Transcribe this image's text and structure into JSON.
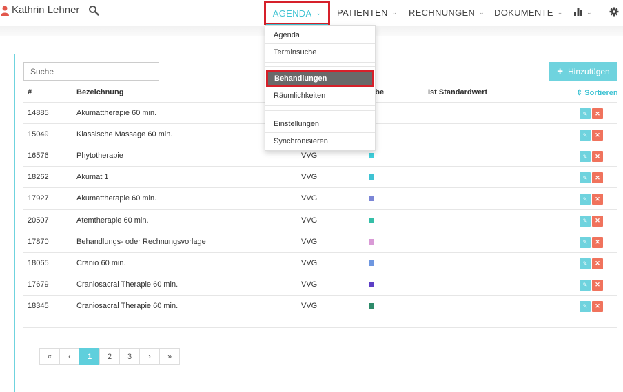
{
  "header": {
    "user_name": "Kathrin Lehner",
    "nav": {
      "agenda": "AGENDA",
      "patienten": "PATIENTEN",
      "rechnungen": "RECHNUNGEN",
      "dokumente": "DOKUMENTE"
    },
    "icons": [
      "user-icon",
      "search-icon",
      "bar-chart-icon",
      "gear-icon"
    ]
  },
  "dropdown": {
    "items": [
      "Agenda",
      "Terminsuche",
      "Behandlungen",
      "Räumlichkeiten",
      "Einstellungen",
      "Synchronisieren"
    ],
    "active": "Behandlungen"
  },
  "toolbar": {
    "search_placeholder": "Suche",
    "add_label": "Hinzufügen"
  },
  "table": {
    "columns": {
      "id": "#",
      "name": "Bezeichnung",
      "color": "rbe",
      "default": "Ist Standardwert",
      "sort": "Sortieren"
    },
    "rows": [
      {
        "id": "14885",
        "name": "Akumattherapie 60 min.",
        "type": "",
        "color": ""
      },
      {
        "id": "15049",
        "name": "Klassische Massage 60 min.",
        "type": "",
        "color": ""
      },
      {
        "id": "16576",
        "name": "Phytotherapie",
        "type": "VVG",
        "color": "#3fd0dc"
      },
      {
        "id": "18262",
        "name": "Akumat 1",
        "type": "VVG",
        "color": "#3fc3d3"
      },
      {
        "id": "17927",
        "name": "Akumattherapie 60 min.",
        "type": "VVG",
        "color": "#7b86d6"
      },
      {
        "id": "20507",
        "name": "Atemtherapie 60 min.",
        "type": "VVG",
        "color": "#35bfa8"
      },
      {
        "id": "17870",
        "name": "Behandlungs- oder Rechnungsvorlage",
        "type": "VVG",
        "color": "#d99ad6"
      },
      {
        "id": "18065",
        "name": "Cranio 60 min.",
        "type": "VVG",
        "color": "#6e97e0"
      },
      {
        "id": "17679",
        "name": "Craniosacral Therapie 60 min.",
        "type": "VVG",
        "color": "#5d3fc6"
      },
      {
        "id": "18345",
        "name": "Craniosacral Therapie 60 min.",
        "type": "VVG",
        "color": "#2e8b6a"
      }
    ]
  },
  "pagination": {
    "first": "«",
    "prev": "‹",
    "pages": [
      "1",
      "2",
      "3"
    ],
    "current": "1",
    "next": "›",
    "last": "»"
  },
  "colors": {
    "accent": "#3fc3d3",
    "delete": "#f0735d",
    "highlight": "#d6202a"
  }
}
